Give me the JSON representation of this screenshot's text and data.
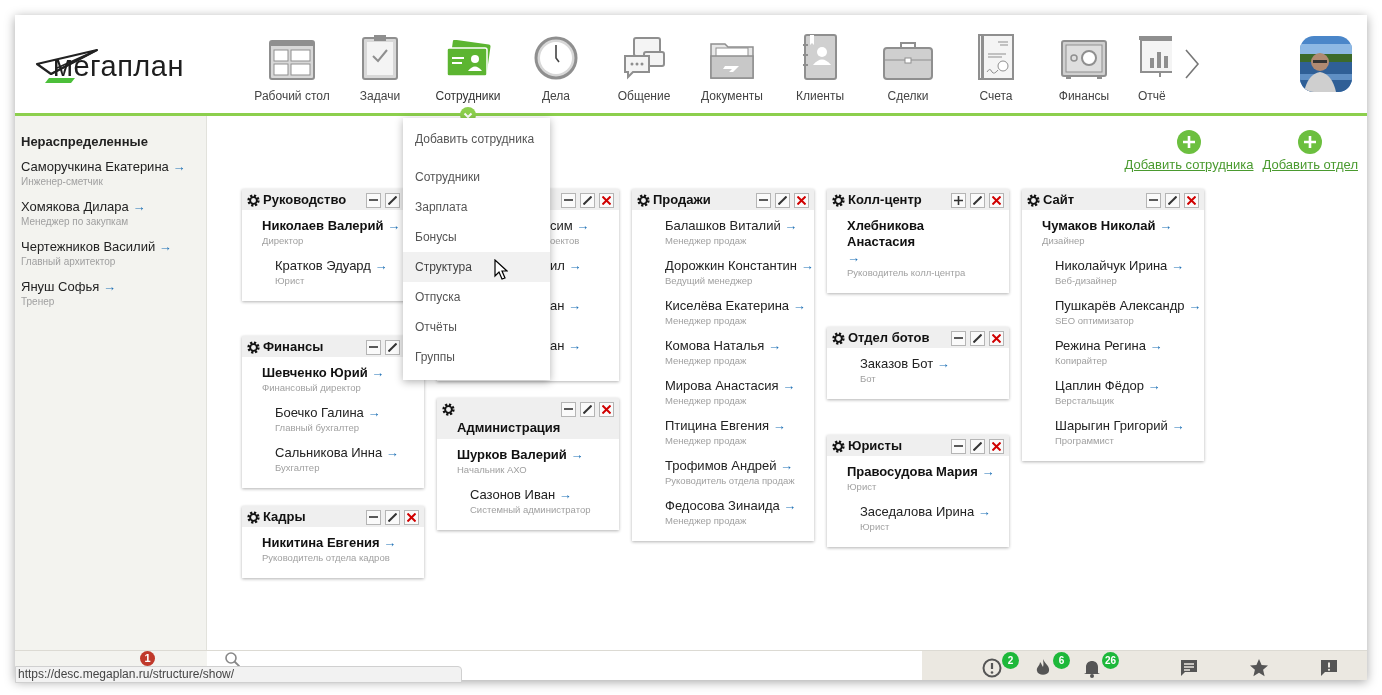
{
  "logo": {
    "text": "мегаплан"
  },
  "nav": [
    {
      "label": "Рабочий стол",
      "selected": false
    },
    {
      "label": "Задачи",
      "selected": false
    },
    {
      "label": "Сотрудники",
      "selected": true
    },
    {
      "label": "Дела",
      "selected": false
    },
    {
      "label": "Общение",
      "selected": false
    },
    {
      "label": "Документы",
      "selected": false
    },
    {
      "label": "Клиенты",
      "selected": false
    },
    {
      "label": "Сделки",
      "selected": false
    },
    {
      "label": "Счета",
      "selected": false
    },
    {
      "label": "Финансы",
      "selected": false
    },
    {
      "label": "Отчё",
      "selected": false,
      "clipped": true
    }
  ],
  "sidebar": {
    "title": "Нераспределенные",
    "people": [
      {
        "name": "Саморучкина Екатерина",
        "arrow": "→",
        "role": "Инженер-сметчик"
      },
      {
        "name": "Хомякова Дилара",
        "arrow": "→",
        "role": "Менеджер по закупкам"
      },
      {
        "name": "Чертежников Василий",
        "arrow": "→",
        "role": "Главный архитектор"
      },
      {
        "name": "Януш Софья",
        "arrow": "→",
        "role": "Тренер"
      }
    ]
  },
  "menu": {
    "items": [
      {
        "label": "Добавить сотрудника",
        "kind": "action",
        "selected": false
      },
      {
        "label": "Сотрудники",
        "kind": "link",
        "selected": false
      },
      {
        "label": "Зарплата",
        "kind": "link",
        "selected": false
      },
      {
        "label": "Бонусы",
        "kind": "link",
        "selected": false
      },
      {
        "label": "Структура",
        "kind": "link",
        "selected": true
      },
      {
        "label": "Отпуска",
        "kind": "link",
        "selected": false
      },
      {
        "label": "Отчёты",
        "kind": "link",
        "selected": false
      },
      {
        "label": "Группы",
        "kind": "link",
        "selected": false
      }
    ]
  },
  "actions": [
    {
      "label": "Добавить сотрудника"
    },
    {
      "label": "Добавить отдел"
    }
  ],
  "departments": [
    {
      "title": "Руководство",
      "buttons": [
        {
          "kind": "collapse"
        },
        {
          "kind": "edit"
        }
      ],
      "people": [
        {
          "name": "Николаев Валерий",
          "arrow": "→",
          "role": "Директор",
          "head": true
        },
        {
          "name": "Кратков Эдуард",
          "arrow": "→",
          "role": "Юрист",
          "head": false
        }
      ]
    },
    {
      "title": "Финансы",
      "buttons": [
        {
          "kind": "collapse"
        },
        {
          "kind": "edit"
        }
      ],
      "people": [
        {
          "name": "Шевченко Юрий",
          "arrow": "→",
          "role": "Финансовый директор",
          "head": true
        },
        {
          "name": "Боечко Галина",
          "arrow": "→",
          "role": "Главный бухгалтер",
          "head": false
        },
        {
          "name": "Сальникова Инна",
          "arrow": "→",
          "role": "Бухгалтер",
          "head": false
        }
      ]
    },
    {
      "title": "Кадры",
      "buttons": [
        {
          "kind": "collapse"
        },
        {
          "kind": "edit"
        },
        {
          "kind": "delete"
        }
      ],
      "people": [
        {
          "name": "Никитина Евгения",
          "arrow": "→",
          "role": "Руководитель отдела кадров",
          "head": true
        }
      ]
    },
    {
      "covered": true,
      "buttons": [
        {
          "kind": "collapse"
        },
        {
          "kind": "edit"
        },
        {
          "kind": "delete"
        }
      ],
      "people": [
        {
          "name": "сим",
          "arrow": "→",
          "role": "оектов",
          "head": false
        },
        {
          "name": "ил",
          "arrow": "→",
          "head": false
        },
        {
          "name": "ан",
          "arrow": "→",
          "head": false
        },
        {
          "name": "ан",
          "arrow": "→",
          "head": false
        }
      ]
    },
    {
      "title": "Администрация",
      "stacked_title": true,
      "buttons": [
        {
          "kind": "collapse"
        },
        {
          "kind": "edit"
        },
        {
          "kind": "delete"
        }
      ],
      "people": [
        {
          "name": "Шурков Валерий",
          "arrow": "→",
          "role": "Начальник АХО",
          "head": true
        },
        {
          "name": "Сазонов Иван",
          "arrow": "→",
          "role": "Системный администратор",
          "head": false
        }
      ]
    },
    {
      "title": "Продажи",
      "buttons": [
        {
          "kind": "collapse"
        },
        {
          "kind": "edit"
        },
        {
          "kind": "delete"
        }
      ],
      "people": [
        {
          "name": "Балашков Виталий",
          "arrow": "→",
          "role": "Менеджер продаж",
          "head": false
        },
        {
          "name": "Дорожкин Константин",
          "arrow": "→",
          "role": "Ведущий менеджер",
          "head": false
        },
        {
          "name": "Киселёва Екатерина",
          "arrow": "→",
          "role": "Менеджер продаж",
          "head": false
        },
        {
          "name": "Комова Наталья",
          "arrow": "→",
          "role": "Менеджер продаж",
          "head": false
        },
        {
          "name": "Мирова Анастасия",
          "arrow": "→",
          "role": "Менеджер продаж",
          "head": false
        },
        {
          "name": "Птицина Евгения",
          "arrow": "→",
          "role": "Менеджер продаж",
          "head": false
        },
        {
          "name": "Трофимов Андрей",
          "arrow": "→",
          "role": "Руководитель отдела продаж",
          "head": false
        },
        {
          "name": "Федосова Зинаида",
          "arrow": "→",
          "role": "Менеджер продаж",
          "head": false
        }
      ]
    },
    {
      "title": "Колл-центр",
      "buttons": [
        {
          "kind": "expand"
        },
        {
          "kind": "edit"
        },
        {
          "kind": "delete"
        }
      ],
      "people": [
        {
          "name": "Хлебникова Анастасия",
          "arrow": "→",
          "role": "Руководитель колл-центра",
          "head": true
        }
      ]
    },
    {
      "title": "Отдел ботов",
      "buttons": [
        {
          "kind": "collapse"
        },
        {
          "kind": "edit"
        },
        {
          "kind": "delete"
        }
      ],
      "people": [
        {
          "name": "Заказов Бот",
          "arrow": "→",
          "role": "Бот",
          "head": false
        }
      ]
    },
    {
      "title": "Юристы",
      "buttons": [
        {
          "kind": "collapse"
        },
        {
          "kind": "edit"
        },
        {
          "kind": "delete"
        }
      ],
      "people": [
        {
          "name": "Правосудова Мария",
          "arrow": "→",
          "role": "Юрист",
          "head": true
        },
        {
          "name": "Заседалова Ирина",
          "arrow": "→",
          "role": "Юрист",
          "head": false
        }
      ]
    },
    {
      "title": "Сайт",
      "buttons": [
        {
          "kind": "collapse"
        },
        {
          "kind": "edit"
        },
        {
          "kind": "delete"
        }
      ],
      "people": [
        {
          "name": "Чумаков Николай",
          "arrow": "→",
          "role": "Дизайнер",
          "head": true
        },
        {
          "name": "Николайчук Ирина",
          "arrow": "→",
          "role": "Веб-дизайнер",
          "head": false
        },
        {
          "name": "Пушкарёв Александр",
          "arrow": "→",
          "role": "SEO оптимизатор",
          "head": false
        },
        {
          "name": "Режина Регина",
          "arrow": "→",
          "role": "Копирайтер",
          "head": false
        },
        {
          "name": "Цаплин Фёдор",
          "arrow": "→",
          "role": "Верстальщик",
          "head": false
        },
        {
          "name": "Шарыгин Григорий",
          "arrow": "→",
          "role": "Программист",
          "head": false
        }
      ]
    }
  ],
  "status_bar": {
    "sidebar_badge": "1",
    "url": "https://desc.megaplan.ru/structure/show/",
    "icons": [
      {
        "kind": "alert",
        "badge": "2"
      },
      {
        "kind": "flame",
        "badge": "6"
      },
      {
        "kind": "bell",
        "badge": "26"
      },
      {
        "kind": "chat"
      },
      {
        "kind": "star"
      },
      {
        "kind": "feedback"
      }
    ]
  }
}
